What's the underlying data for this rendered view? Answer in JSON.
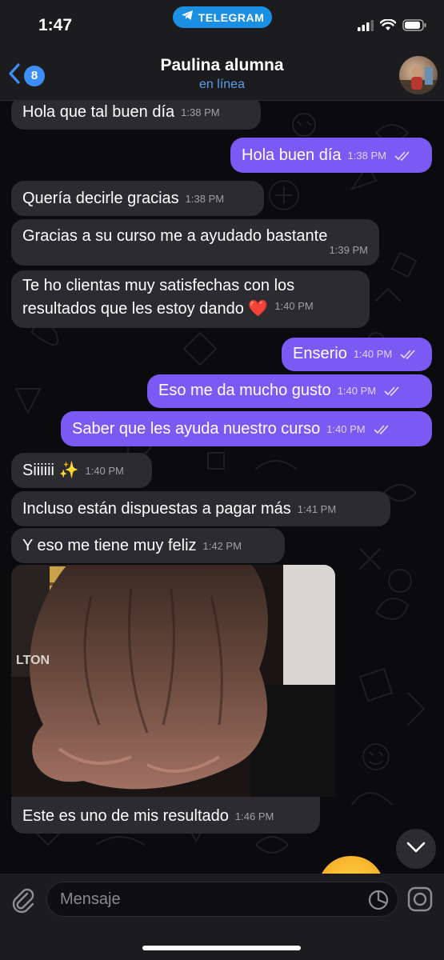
{
  "status_bar": {
    "time": "1:47",
    "app_pill": "TELEGRAM"
  },
  "header": {
    "back_count": "8",
    "title": "Paulina alumna",
    "status": "en línea"
  },
  "messages": [
    {
      "dir": "in",
      "text": "Hola que tal buen día",
      "time": "1:38 PM"
    },
    {
      "dir": "out",
      "text": "Hola buen día",
      "time": "1:38 PM"
    },
    {
      "dir": "in",
      "text": "Quería decirle gracias",
      "time": "1:38 PM"
    },
    {
      "dir": "in",
      "text": "Gracias a su curso me a ayudado bastante",
      "time": "1:39 PM"
    },
    {
      "dir": "in",
      "text": "Te ho clientas muy satisfechas con los",
      "text2": "resultados que les estoy dando ❤️",
      "time": "1:40 PM"
    },
    {
      "dir": "out",
      "text": "Enserio",
      "time": "1:40 PM"
    },
    {
      "dir": "out",
      "text": "Eso me da mucho gusto",
      "time": "1:40 PM"
    },
    {
      "dir": "out",
      "text": "Saber que les ayuda nuestro curso",
      "time": "1:40 PM"
    },
    {
      "dir": "in",
      "text": "Siiiiii ✨",
      "time": "1:40 PM"
    },
    {
      "dir": "in",
      "text": "Incluso están dispuestas a pagar más",
      "time": "1:41 PM"
    },
    {
      "dir": "in",
      "text": "Y eso me tiene muy feliz",
      "time": "1:42 PM"
    },
    {
      "dir": "in",
      "text": "Este es uno de mis resultado",
      "time": "1:46 PM"
    }
  ],
  "photo": {
    "sign_text": "LTON"
  },
  "composer": {
    "placeholder": "Mensaje"
  },
  "colors": {
    "outgoing": "#7b59f3",
    "incoming": "#2b2b30",
    "accent": "#3e8ef7",
    "telegram": "#1a8fe3"
  },
  "icons": [
    "back-chevron-icon",
    "telegram-plane-icon",
    "signal-icon",
    "wifi-icon",
    "battery-icon",
    "read-checks-icon",
    "heart-icon",
    "sparkles-icon",
    "chevron-down-icon",
    "paperclip-icon",
    "sticker-icon",
    "camera-icon"
  ]
}
